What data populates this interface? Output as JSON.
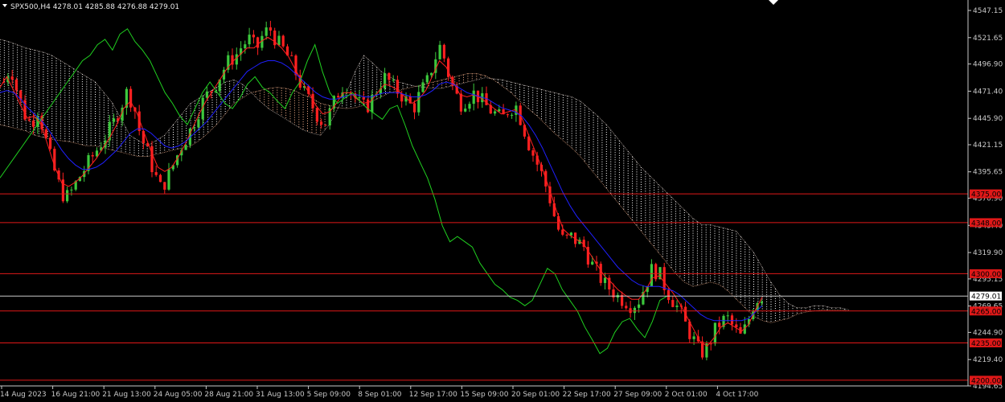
{
  "header": {
    "symbol_info": "SPX500,H4  4278.01 4285.88 4276.88 4279.01"
  },
  "chart_data": {
    "type": "candlestick",
    "title": "SPX500,H4  4278.01 4285.88 4276.88 4279.01",
    "xlabel": "",
    "ylabel": "",
    "ylim": [
      4194.65,
      4557.0
    ],
    "y_ticks": [
      "4547.15",
      "4521.65",
      "4496.90",
      "4471.40",
      "4445.90",
      "4421.15",
      "4395.65",
      "4370.90",
      "4345.40",
      "4319.90",
      "4295.15",
      "4269.65",
      "4244.90",
      "4219.40",
      "4194.65"
    ],
    "x_ticks": [
      "14 Aug 2023",
      "16 Aug 21:00",
      "21 Aug 13:00",
      "24 Aug 05:00",
      "28 Aug 21:00",
      "31 Aug 13:00",
      "5 Sep 09:00",
      "8 Sep 01:00",
      "12 Sep 17:00",
      "15 Sep 09:00",
      "20 Sep 01:00",
      "22 Sep 17:00",
      "27 Sep 09:00",
      "2 Oct 01:00",
      "4 Oct 17:00"
    ],
    "current_price": {
      "label": "4279.01",
      "value": 4279.01
    },
    "horizontal_levels": [
      {
        "label": "4375.00",
        "value": 4375.0
      },
      {
        "label": "4348.00",
        "value": 4348.0
      },
      {
        "label": "4300.00",
        "value": 4300.0
      },
      {
        "label": "4265.00",
        "value": 4265.0
      },
      {
        "label": "4235.00",
        "value": 4235.0
      },
      {
        "label": "4200.00",
        "value": 4200.0
      }
    ],
    "close_path": [
      4480,
      4495,
      4470,
      4450,
      4440,
      4455,
      4430,
      4405,
      4385,
      4370,
      4378,
      4390,
      4400,
      4410,
      4420,
      4430,
      4440,
      4455,
      4470,
      4460,
      4430,
      4415,
      4395,
      4380,
      4390,
      4405,
      4420,
      4430,
      4445,
      4460,
      4470,
      4478,
      4490,
      4500,
      4505,
      4515,
      4520,
      4510,
      4525,
      4530,
      4518,
      4510,
      4500,
      4485,
      4470,
      4460,
      4448,
      4440,
      4455,
      4470,
      4480,
      4470,
      4460,
      4455,
      4465,
      4478,
      4485,
      4475,
      4470,
      4462,
      4455,
      4470,
      4480,
      4500,
      4515,
      4490,
      4470,
      4460,
      4465,
      4470,
      4462,
      4455,
      4450,
      4445,
      4455,
      4458,
      4440,
      4420,
      4405,
      4390,
      4370,
      4345,
      4330,
      4335,
      4330,
      4325,
      4310,
      4300,
      4290,
      4285,
      4278,
      4275,
      4270,
      4275,
      4290,
      4305,
      4300,
      4285,
      4275,
      4265,
      4250,
      4238,
      4225,
      4230,
      4245,
      4255,
      4258,
      4248,
      4240,
      4255,
      4275,
      4279.01
    ],
    "series": [
      {
        "name": "",
        "color": "#ff2020",
        "role": "tenkan",
        "values": [
          4475,
          4485,
          4472,
          4458,
          4446,
          4448,
          4440,
          4420,
          4400,
          4385,
          4382,
          4386,
          4392,
          4400,
          4408,
          4418,
          4428,
          4440,
          4455,
          4462,
          4450,
          4432,
          4415,
          4400,
          4396,
          4400,
          4410,
          4422,
          4436,
          4450,
          4462,
          4472,
          4482,
          4492,
          4500,
          4506,
          4512,
          4512,
          4518,
          4522,
          4518,
          4512,
          4504,
          4492,
          4480,
          4470,
          4458,
          4450,
          4452,
          4460,
          4470,
          4470,
          4464,
          4460,
          4462,
          4470,
          4478,
          4476,
          4472,
          4466,
          4460,
          4464,
          4472,
          4486,
          4500,
          4494,
          4480,
          4468,
          4466,
          4468,
          4465,
          4460,
          4455,
          4450,
          4452,
          4454,
          4446,
          4430,
          4414,
          4398,
          4380,
          4360,
          4342,
          4336,
          4332,
          4328,
          4318,
          4308,
          4298,
          4292,
          4285,
          4280,
          4276,
          4276,
          4284,
          4296,
          4298,
          4290,
          4282,
          4272,
          4260,
          4248,
          4236,
          4232,
          4240,
          4250,
          4254,
          4250,
          4246,
          4252,
          4266,
          4278
        ]
      },
      {
        "name": "",
        "color": "#2020ff",
        "role": "kijun",
        "values": [
          4470,
          4472,
          4470,
          4464,
          4456,
          4450,
          4444,
          4436,
          4426,
          4416,
          4408,
          4402,
          4398,
          4398,
          4400,
          4404,
          4410,
          4416,
          4424,
          4432,
          4436,
          4436,
          4432,
          4426,
          4420,
          4418,
          4420,
          4424,
          4430,
          4436,
          4442,
          4450,
          4458,
          4466,
          4474,
          4482,
          4490,
          4494,
          4498,
          4500,
          4500,
          4498,
          4494,
          4488,
          4482,
          4476,
          4470,
          4466,
          4464,
          4464,
          4466,
          4468,
          4468,
          4466,
          4466,
          4468,
          4470,
          4470,
          4470,
          4468,
          4466,
          4466,
          4468,
          4472,
          4478,
          4480,
          4478,
          4474,
          4470,
          4468,
          4466,
          4464,
          4460,
          4456,
          4454,
          4452,
          4448,
          4440,
          4430,
          4418,
          4404,
          4390,
          4376,
          4364,
          4354,
          4346,
          4338,
          4330,
          4322,
          4314,
          4306,
          4300,
          4294,
          4290,
          4288,
          4288,
          4288,
          4286,
          4284,
          4280,
          4274,
          4268,
          4262,
          4258,
          4256,
          4256,
          4256,
          4256,
          4256,
          4258,
          4264,
          4270
        ]
      },
      {
        "name": "",
        "color": "#20d020",
        "role": "chikou",
        "values": [
          4390,
          4400,
          4410,
          4420,
          4430,
          4440,
          4450,
          4460,
          4470,
          4480,
          4490,
          4500,
          4505,
          4515,
          4520,
          4510,
          4525,
          4530,
          4518,
          4510,
          4500,
          4485,
          4470,
          4460,
          4448,
          4440,
          4455,
          4470,
          4480,
          4470,
          4460,
          4455,
          4465,
          4478,
          4485,
          4475,
          4470,
          4462,
          4455,
          4470,
          4480,
          4500,
          4515,
          4490,
          4470,
          4460,
          4465,
          4470,
          4462,
          4455,
          4450,
          4445,
          4455,
          4458,
          4440,
          4420,
          4405,
          4390,
          4370,
          4345,
          4330,
          4335,
          4330,
          4325,
          4310,
          4300,
          4290,
          4285,
          4278,
          4275,
          4270,
          4275,
          4290,
          4305,
          4300,
          4285,
          4275,
          4265,
          4250,
          4238,
          4225,
          4230,
          4245,
          4255,
          4258,
          4248,
          4240,
          4255,
          4275,
          4279.01
        ]
      },
      {
        "name": "",
        "color": "#ffffff",
        "role": "cloud_upper",
        "values": [
          4520,
          4518,
          4515,
          4512,
          4510,
          4508,
          4505,
          4500,
          4495,
          4490,
          4485,
          4480,
          4470,
          4460,
          4445,
          4430,
          4425,
          4420,
          4425,
          4430,
          4440,
          4450,
          4460,
          4465,
          4470,
          4475,
          4480,
          4482,
          4478,
          4470,
          4462,
          4455,
          4450,
          4445,
          4440,
          4435,
          4432,
          4430,
          4440,
          4455,
          4470,
          4490,
          4505,
          4498,
          4490,
          4485,
          4480,
          4478,
          4476,
          4475,
          4474,
          4474,
          4476,
          4478,
          4480,
          4482,
          4484,
          4483,
          4482,
          4480,
          4478,
          4476,
          4474,
          4472,
          4470,
          4468,
          4466,
          4462,
          4455,
          4448,
          4440,
          4430,
          4420,
          4410,
          4400,
          4392,
          4384,
          4376,
          4368,
          4360,
          4352,
          4346,
          4346,
          4344,
          4342,
          4340,
          4330,
          4320,
          4306,
          4292,
          4280,
          4272,
          4268,
          4268,
          4270,
          4270,
          4268,
          4268,
          4266
        ]
      },
      {
        "name": "",
        "color": "#ffb890",
        "role": "cloud_lower",
        "values": [
          4440,
          4438,
          4436,
          4434,
          4430,
          4428,
          4426,
          4425,
          4424,
          4422,
          4420,
          4420,
          4418,
          4416,
          4414,
          4412,
          4410,
          4410,
          4412,
          4414,
          4416,
          4418,
          4420,
          4425,
          4432,
          4440,
          4450,
          4460,
          4465,
          4470,
          4472,
          4474,
          4475,
          4474,
          4472,
          4468,
          4465,
          4460,
          4458,
          4456,
          4455,
          4456,
          4458,
          4462,
          4466,
          4470,
          4472,
          4474,
          4476,
          4478,
          4480,
          4482,
          4484,
          4486,
          4488,
          4488,
          4486,
          4482,
          4476,
          4470,
          4462,
          4455,
          4448,
          4440,
          4432,
          4425,
          4418,
          4410,
          4400,
          4390,
          4380,
          4370,
          4360,
          4350,
          4340,
          4330,
          4320,
          4310,
          4300,
          4292,
          4288,
          4290,
          4292,
          4290,
          4284,
          4276,
          4268,
          4260,
          4256,
          4254,
          4256,
          4258,
          4262,
          4264,
          4265,
          4266,
          4266,
          4266,
          4265
        ]
      }
    ]
  }
}
